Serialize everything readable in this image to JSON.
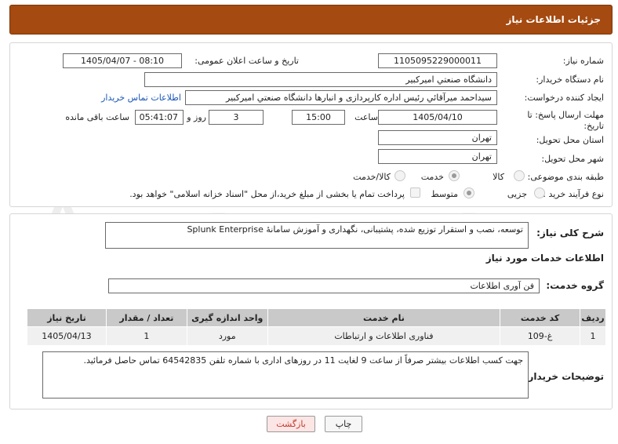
{
  "header": {
    "title": "جزئیات اطلاعات نیاز"
  },
  "form": {
    "need_number_label": "شماره نیاز:",
    "need_number": "1105095229000011",
    "announce_label": "تاریخ و ساعت اعلان عمومی:",
    "announce_value": "1405/04/07 - 08:10",
    "buyer_org_label": "نام دستگاه خریدار:",
    "buyer_org": "دانشگاه صنعتي اميركبير",
    "creator_label": "ایجاد کننده درخواست:",
    "creator": "سیداحمد میرآقائي رئیس اداره کارپردازی و انبارها دانشگاه صنعتي اميركبير",
    "buyer_contact_link": "اطلاعات تماس خریدار",
    "deadline_label": "مهلت ارسال پاسخ: تا تاریخ:",
    "deadline_date": "1405/04/10",
    "time_label": "ساعت",
    "deadline_time": "15:00",
    "days_value": "3",
    "days_label": "روز و",
    "remaining_time": "05:41:07",
    "remaining_label": "ساعت باقی مانده",
    "province_label": "استان محل تحویل:",
    "province": "تهران",
    "city_label": "شهر محل تحویل:",
    "city": "تهران",
    "category_label": "طبقه بندی موضوعی:",
    "category_options": [
      "کالا",
      "خدمت",
      "کالا/خدمت"
    ],
    "category_selected": "خدمت",
    "process_label": "نوع فرآیند خرید :",
    "process_options": [
      "جزیی",
      "متوسط"
    ],
    "process_selected": "متوسط",
    "treasury_note": "پرداخت تمام یا بخشی از مبلغ خرید،از محل \"اسناد خزانه اسلامی\" خواهد بود."
  },
  "details": {
    "description_label": "شرح کلی نیاز:",
    "description": "توسعه، نصب و استقرار توزیع شده، پشتیبانی، نگهداری و آموزش سامانۀ Splunk Enterprise",
    "services_info_title": "اطلاعات خدمات مورد نیاز",
    "service_group_label": "گروه خدمت:",
    "service_group": "فن آوری اطلاعات",
    "table_headers": [
      "ردیف",
      "کد خدمت",
      "نام خدمت",
      "واحد اندازه گیری",
      "تعداد / مقدار",
      "تاریخ نیاز"
    ],
    "table_rows": [
      [
        "1",
        "غ-109",
        "فناوری اطلاعات و ارتباطات",
        "مورد",
        "1",
        "1405/04/13"
      ]
    ],
    "buyer_notes_label": "توضیحات خریدار:",
    "buyer_notes": "جهت کسب اطلاعات بیشتر صرفاً از ساعت 9 لغایت 11 در روزهای اداری با شماره تلفن 64542835 تماس حاصل فرمائید."
  },
  "buttons": {
    "print": "چاپ",
    "back": "بازگشت"
  },
  "watermark_text": "AriaTender.neT",
  "colors": {
    "header_bg": "#a54a10",
    "link": "#1a56b8",
    "back_button_text": "#c0392b"
  }
}
